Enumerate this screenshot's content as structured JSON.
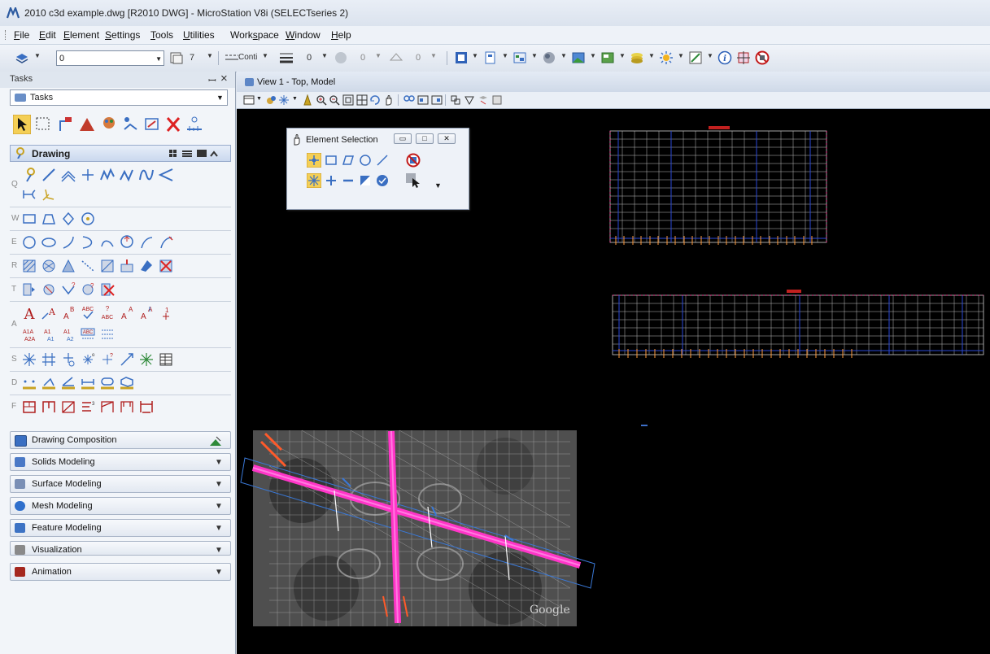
{
  "window": {
    "title": "2010 c3d example.dwg [R2010 DWG] - MicroStation V8i (SELECTseries 2)"
  },
  "menu": [
    {
      "label": "File",
      "u": "F",
      "rest": "ile"
    },
    {
      "label": "Edit",
      "u": "E",
      "rest": "dit"
    },
    {
      "label": "Element",
      "u": "E",
      "rest": "lement"
    },
    {
      "label": "Settings",
      "u": "S",
      "rest": "ettings"
    },
    {
      "label": "Tools",
      "u": "T",
      "rest": "ools"
    },
    {
      "label": "Utilities",
      "u": "U",
      "rest": "tilities"
    },
    {
      "label": "Workspace",
      "pre": "Work",
      "u": "s",
      "rest": "pace"
    },
    {
      "label": "Window",
      "u": "W",
      "rest": "indow"
    },
    {
      "label": "Help",
      "u": "H",
      "rest": "elp"
    }
  ],
  "attributes": {
    "level": "0",
    "color": "7",
    "linestyle": "Conti",
    "weight": "0",
    "transparency": "0",
    "priority": "0"
  },
  "tasks": {
    "panel_title": "Tasks",
    "combo_value": "Tasks",
    "drawing_label": "Drawing",
    "row_keys": [
      "Q",
      "W",
      "E",
      "R",
      "T",
      "A",
      "S",
      "D",
      "F"
    ],
    "groups": [
      {
        "label": "Drawing Composition",
        "icon": "drawing-composition-icon",
        "color": "#3a6fc2"
      },
      {
        "label": "Solids Modeling",
        "icon": "solids-modeling-icon",
        "color": "#4a79c6"
      },
      {
        "label": "Surface Modeling",
        "icon": "surface-modeling-icon",
        "color": "#7a8fb5"
      },
      {
        "label": "Mesh Modeling",
        "icon": "mesh-modeling-icon",
        "color": "#2f6fcc"
      },
      {
        "label": "Feature Modeling",
        "icon": "feature-modeling-icon",
        "color": "#3d73c4"
      },
      {
        "label": "Visualization",
        "icon": "visualization-icon",
        "color": "#8a8a8a"
      },
      {
        "label": "Animation",
        "icon": "animation-icon",
        "color": "#a5281f"
      }
    ]
  },
  "view": {
    "title": "View 1 - Top, Model"
  },
  "element_selection": {
    "title": "Element Selection"
  },
  "map": {
    "watermark": "Google"
  }
}
